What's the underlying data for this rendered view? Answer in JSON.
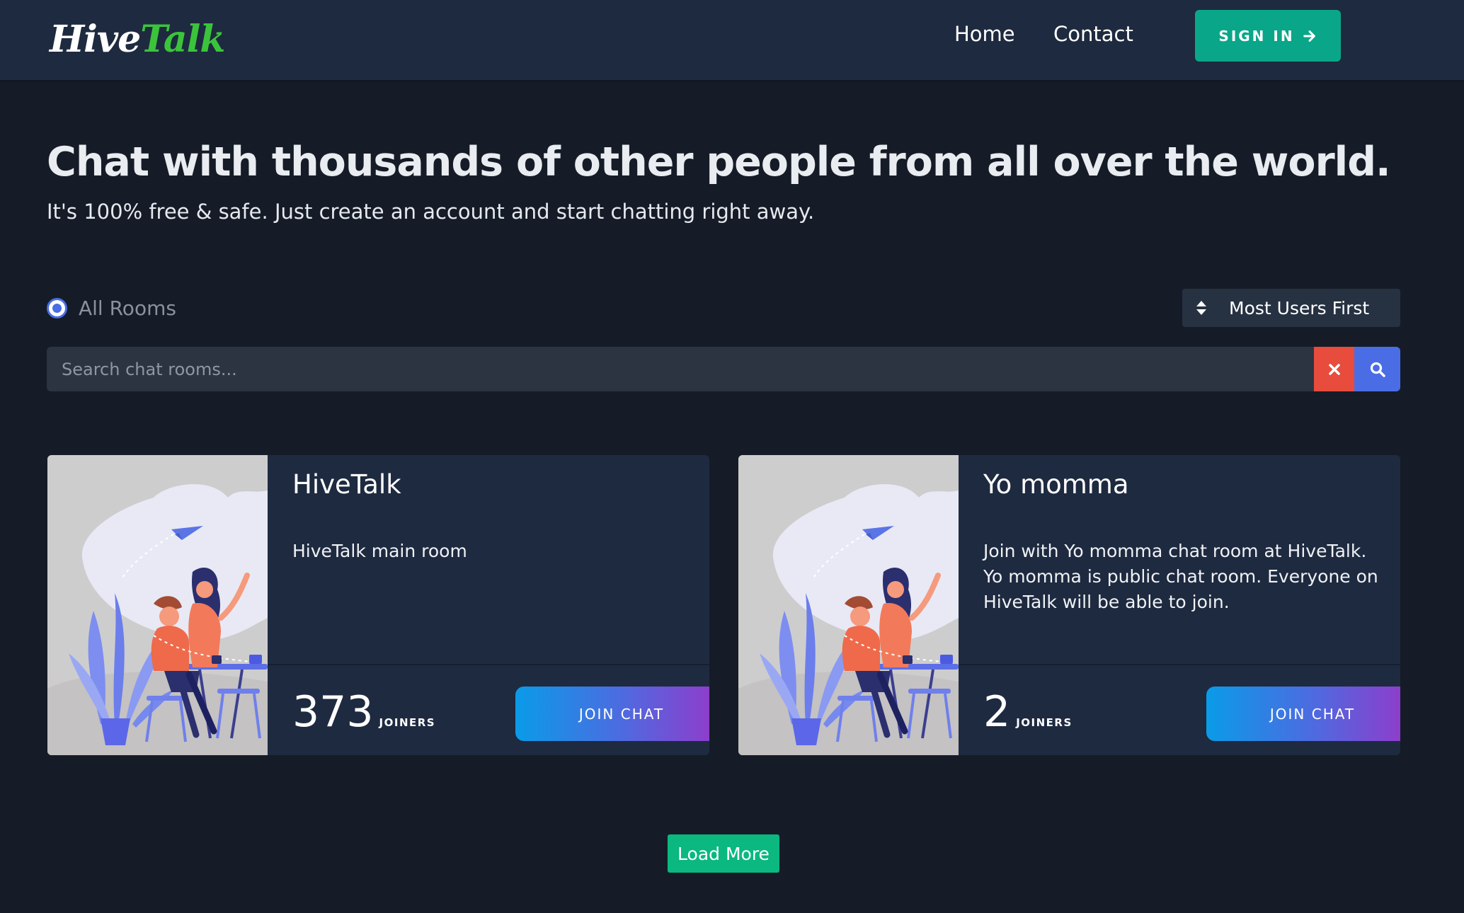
{
  "header": {
    "logo": {
      "part1": "Hive",
      "part2": "Talk"
    },
    "nav": [
      {
        "label": "Home"
      },
      {
        "label": "Contact"
      }
    ],
    "sign_in_label": "SIGN IN"
  },
  "hero": {
    "title": "Chat with thousands of other people from all over the world.",
    "subtitle": "It's 100% free & safe. Just create an account and start chatting right away."
  },
  "filters": {
    "radio_label": "All Rooms",
    "radio_selected": true,
    "sort_label": "Most Users First"
  },
  "search": {
    "placeholder": "Search chat rooms...",
    "value": ""
  },
  "rooms": [
    {
      "title": "HiveTalk",
      "description": "HiveTalk main room",
      "joiners": "373",
      "joiners_label": "JOINERS",
      "join_label": "JOIN CHAT",
      "image_icon": "people-chatting-illustration"
    },
    {
      "title": "Yo momma",
      "description": "Join with Yo momma chat room at HiveTalk. Yo momma is public chat room. Everyone on HiveTalk will be able to join.",
      "joiners": "2",
      "joiners_label": "JOINERS",
      "join_label": "JOIN CHAT",
      "image_icon": "people-chatting-illustration"
    }
  ],
  "load_more_label": "Load More",
  "colors": {
    "background": "#151c27",
    "navbar": "#1e2a3f",
    "accent_green": "#0aa689",
    "accent_blue": "#4a6de5",
    "danger_red": "#e74c3c",
    "card": "#1e2a40",
    "logo_green": "#3bc43b"
  }
}
